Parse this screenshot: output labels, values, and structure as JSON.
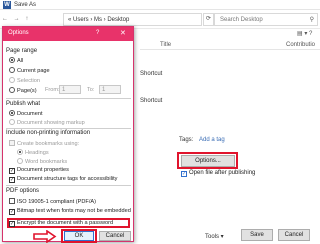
{
  "window": {
    "title": "Save As"
  },
  "address": {
    "path": "« Users › Ms › Desktop",
    "search_placeholder": "Search Desktop"
  },
  "columns": {
    "title": "Title",
    "contributors": "Contributio"
  },
  "files": [
    "Shortcut",
    "Shortcut"
  ],
  "tags": {
    "label": "Tags:",
    "add": "Add a tag"
  },
  "options_button": "Options...",
  "open_after": "Open file after publishing",
  "footer": {
    "tools": "Tools",
    "save": "Save",
    "cancel": "Cancel"
  },
  "dialog": {
    "title": "Options",
    "help": "?",
    "close": "✕",
    "page_range": {
      "heading": "Page range",
      "all": "All",
      "current": "Current page",
      "selection": "Selection",
      "pages": "Page(s)",
      "from_label": "From:",
      "from_value": "1",
      "to_label": "To:",
      "to_value": "1"
    },
    "publish_what": {
      "heading": "Publish what",
      "document": "Document",
      "markup": "Document showing markup"
    },
    "non_printing": {
      "heading": "Include non-printing information",
      "create_bookmarks": "Create bookmarks using:",
      "headings": "Headings",
      "word_bookmarks": "Word bookmarks",
      "properties": "Document properties",
      "structure_tags": "Document structure tags for accessibility"
    },
    "pdf_options": {
      "heading": "PDF options",
      "iso": "ISO 19005-1 compliant (PDF/A)",
      "bitmap": "Bitmap text when fonts may not be embedded",
      "encrypt": "Encrypt the document with a password"
    },
    "ok": "OK",
    "cancel": "Cancel"
  },
  "colors": {
    "accent": "#e8336a",
    "highlight": "#e0142d"
  }
}
